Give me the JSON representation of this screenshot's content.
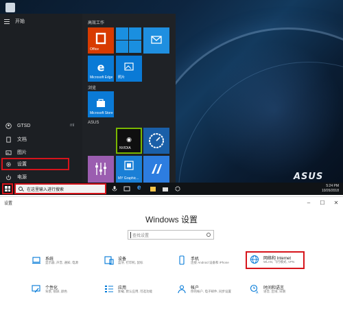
{
  "start_menu": {
    "header": "开始",
    "user": "GTSD",
    "items": [
      "文档",
      "图片",
      "设置",
      "电源"
    ],
    "side_mark": "ml",
    "groups": [
      "高效工作",
      "浏览",
      "ASUS"
    ],
    "tiles": {
      "office": "Office",
      "edge": "Microsoft Edge",
      "photos": "照片",
      "store": "Microsoft Store",
      "nvidia": "NVIDIA",
      "mygraphics": "MY Graphic..."
    }
  },
  "taskbar": {
    "search_placeholder": "在这里输入进行搜索",
    "time": "5:24 PM",
    "date": "10/26/2018"
  },
  "desktop": {
    "brand": "ASUS"
  },
  "settings": {
    "window_title": "设置",
    "heading": "Windows 设置",
    "search_placeholder": "查找设置",
    "categories": [
      {
        "title": "系统",
        "subtitle": "显示器, 声音, 通知, 电源"
      },
      {
        "title": "设备",
        "subtitle": "蓝牙, 打印机, 鼠标"
      },
      {
        "title": "手机",
        "subtitle": "连接 Android 设备和 iPhone"
      },
      {
        "title": "网络和 Internet",
        "subtitle": "WLAN, 飞行模式, VPN"
      },
      {
        "title": "个性化",
        "subtitle": "背景, 锁屏, 颜色"
      },
      {
        "title": "应用",
        "subtitle": "卸载, 默认应用, 可选功能"
      },
      {
        "title": "帐户",
        "subtitle": "你的帐户, 电子邮件, 同步设置"
      },
      {
        "title": "时间和语言",
        "subtitle": "语音, 区域, 日期"
      }
    ]
  },
  "colors": {
    "accent": "#0078d7",
    "highlight": "#d6141b",
    "office": "#d83b01"
  }
}
